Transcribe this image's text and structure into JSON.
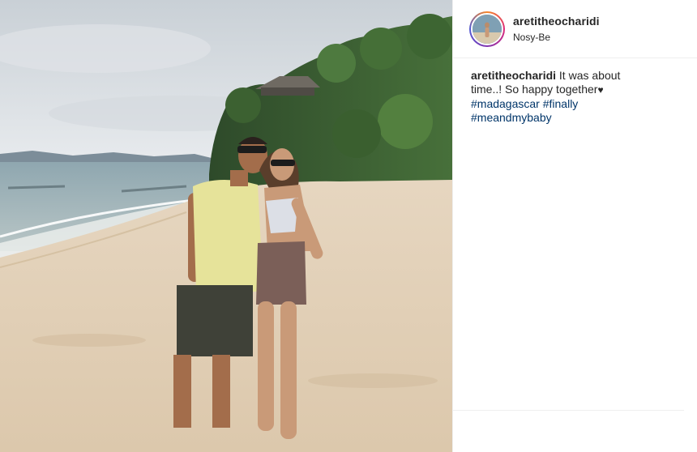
{
  "post": {
    "image_alt": "",
    "author": {
      "username": "aretitheocharidi",
      "location": "Nosy-Be",
      "avatar_icon": "profile-avatar"
    },
    "caption": {
      "username": "aretitheocharidi",
      "text_part1": "It was about time..! So happy together",
      "heart": "♥",
      "hashtags": [
        "#madagascar",
        "#finally",
        "#meandmybaby"
      ]
    },
    "colors": {
      "accent_link": "#003569",
      "text": "#262626",
      "divider": "#efefef"
    }
  }
}
